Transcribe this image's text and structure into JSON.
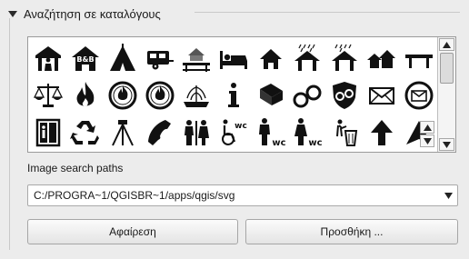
{
  "group": {
    "title": "Αναζήτηση σε καταλόγους",
    "collapse_icon": "triangle-down-icon"
  },
  "icon_grid": {
    "icons": [
      "tourist-info-icon",
      "hostel-bb-icon",
      "camping-tent-icon",
      "caravan-park-icon",
      "picnic-chalet-icon",
      "hotel-bed-icon",
      "house-icon",
      "shelter-rain-icon",
      "shelter-icon",
      "settlement-icon",
      "bench-icon",
      "court-scales-icon",
      "fire-icon",
      "fire-station-icon",
      "fire-brigade-icon",
      "fountain-icon",
      "information-icon",
      "library-book-icon",
      "handcuffs-icon",
      "police-icon",
      "mail-icon",
      "post-office-icon",
      "elevator-icon",
      "recycling-icon",
      "survey-point-icon",
      "telephone-icon",
      "toilets-icon",
      "wheelchair-wc-icon",
      "men-wc-icon",
      "women-wc-icon",
      "waste-basket-icon",
      "arrow-up-icon",
      "peak-icon"
    ],
    "scroll_up_icon": "chevron-up-icon",
    "scroll_down_icon": "chevron-down-icon"
  },
  "paths": {
    "label": "Image search paths",
    "selected": "C:/PROGRA~1/QGISBR~1/apps/qgis/svg",
    "dropdown_icon": "chevron-down-icon"
  },
  "buttons": {
    "remove": "Αφαίρεση",
    "add": "Προσθήκη ..."
  }
}
